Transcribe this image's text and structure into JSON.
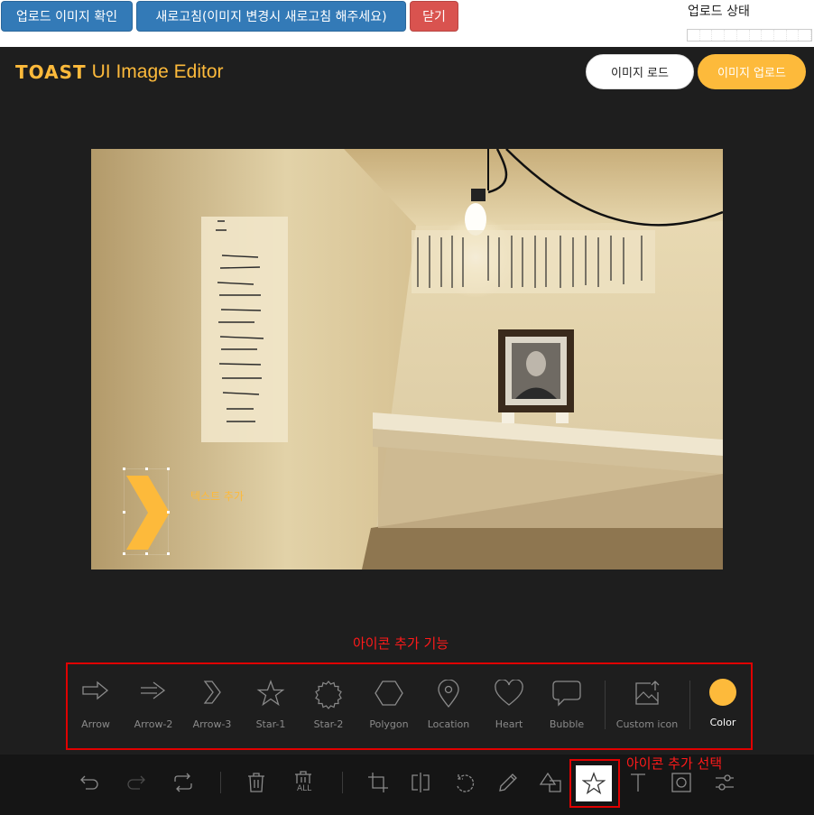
{
  "topbar": {
    "upload_check_label": "업로드 이미지 확인",
    "refresh_label": "새로고침(이미지 변경시 새로고침 해주세요)",
    "close_label": "닫기",
    "upload_status_label": "업로드 상태",
    "progress": 0
  },
  "editor": {
    "logo_brand": "TOAST",
    "logo_rest": "UI Image Editor",
    "load_button": "이미지 로드",
    "upload_button": "이미지 업로드",
    "canvas_text": "텍스트 추가"
  },
  "annotations": {
    "icon_feature": "아이콘 추가 기능",
    "icon_select": "아이콘 추가 선택"
  },
  "colors": {
    "accent": "#fdba3b",
    "annotation": "#ff1a1a",
    "editor_bg": "#1e1e1e",
    "menu_bg": "#151515"
  },
  "icon_submenu": {
    "items": [
      {
        "label": "Arrow",
        "icon": "arrow-icon"
      },
      {
        "label": "Arrow-2",
        "icon": "arrow-2-icon"
      },
      {
        "label": "Arrow-3",
        "icon": "arrow-3-icon"
      },
      {
        "label": "Star-1",
        "icon": "star-1-icon"
      },
      {
        "label": "Star-2",
        "icon": "star-2-icon"
      },
      {
        "label": "Polygon",
        "icon": "polygon-icon"
      },
      {
        "label": "Location",
        "icon": "location-icon"
      },
      {
        "label": "Heart",
        "icon": "heart-icon"
      },
      {
        "label": "Bubble",
        "icon": "bubble-icon"
      },
      {
        "label": "Custom icon",
        "icon": "custom-icon-upload-icon"
      },
      {
        "label": "Color",
        "icon": "color-swatch-icon"
      }
    ]
  },
  "menu": {
    "items": [
      "undo-icon",
      "redo-icon",
      "reset-icon",
      "delete-icon",
      "delete-all-icon",
      "crop-icon",
      "flip-icon",
      "rotate-icon",
      "draw-icon",
      "shape-icon",
      "icon-star-icon",
      "text-icon",
      "mask-icon",
      "filter-icon"
    ],
    "delete_all_text": "ALL",
    "active": "icon-star-icon"
  }
}
